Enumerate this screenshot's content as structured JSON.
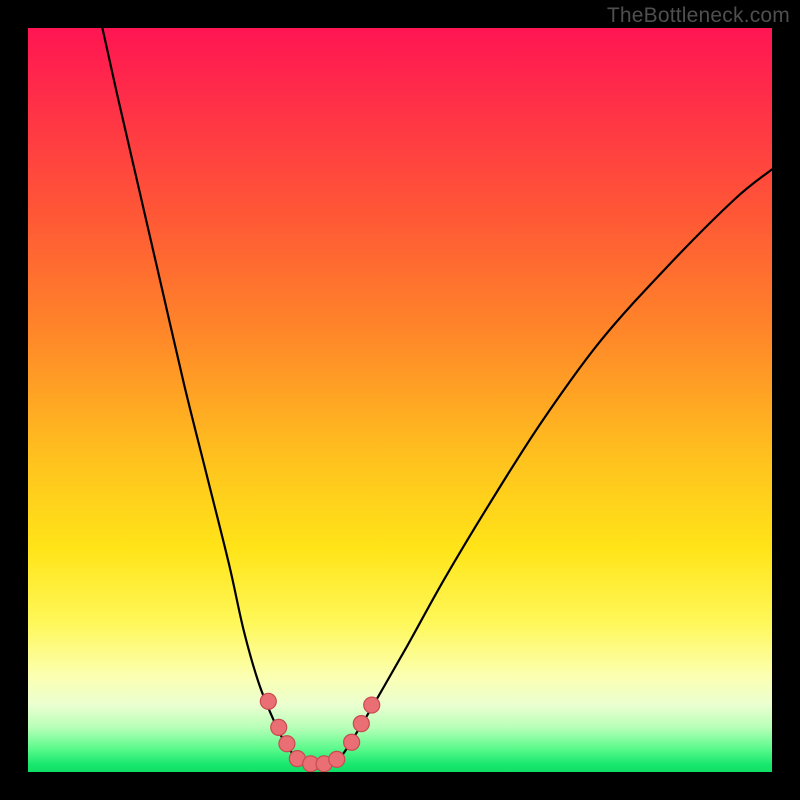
{
  "watermark": "TheBottleneck.com",
  "chart_data": {
    "type": "line",
    "title": "",
    "xlabel": "",
    "ylabel": "",
    "xlim": [
      0,
      100
    ],
    "ylim": [
      0,
      100
    ],
    "series": [
      {
        "name": "left-curve",
        "x": [
          10,
          12,
          15,
          18,
          21,
          24,
          27,
          29,
          31,
          33,
          34.5,
          36
        ],
        "y": [
          100,
          91,
          78,
          65,
          52,
          40,
          28,
          19,
          12,
          7,
          4,
          2
        ]
      },
      {
        "name": "right-curve",
        "x": [
          42,
          44,
          47,
          51,
          56,
          62,
          69,
          77,
          86,
          95,
          100
        ],
        "y": [
          2,
          5,
          10,
          17,
          26,
          36,
          47,
          58,
          68,
          77,
          81
        ]
      },
      {
        "name": "valley-floor",
        "x": [
          36,
          37.5,
          39,
          40.5,
          42
        ],
        "y": [
          2,
          1.2,
          1,
          1.2,
          2
        ]
      }
    ],
    "markers": [
      {
        "series": "left-curve",
        "x": 32.3,
        "y": 9.5
      },
      {
        "series": "left-curve",
        "x": 33.7,
        "y": 6.0
      },
      {
        "series": "left-curve",
        "x": 34.8,
        "y": 3.8
      },
      {
        "series": "valley-floor",
        "x": 36.2,
        "y": 1.8
      },
      {
        "series": "valley-floor",
        "x": 38.0,
        "y": 1.1
      },
      {
        "series": "valley-floor",
        "x": 39.8,
        "y": 1.1
      },
      {
        "series": "valley-floor",
        "x": 41.5,
        "y": 1.7
      },
      {
        "series": "right-curve",
        "x": 43.5,
        "y": 4.0
      },
      {
        "series": "right-curve",
        "x": 44.8,
        "y": 6.5
      },
      {
        "series": "right-curve",
        "x": 46.2,
        "y": 9.0
      }
    ],
    "marker_style": {
      "fill": "#e96f74",
      "stroke": "#c94a50",
      "r": 8
    },
    "curve_style": {
      "stroke": "#000000",
      "width": 2.2
    },
    "background": "rainbow-vertical-gradient"
  }
}
